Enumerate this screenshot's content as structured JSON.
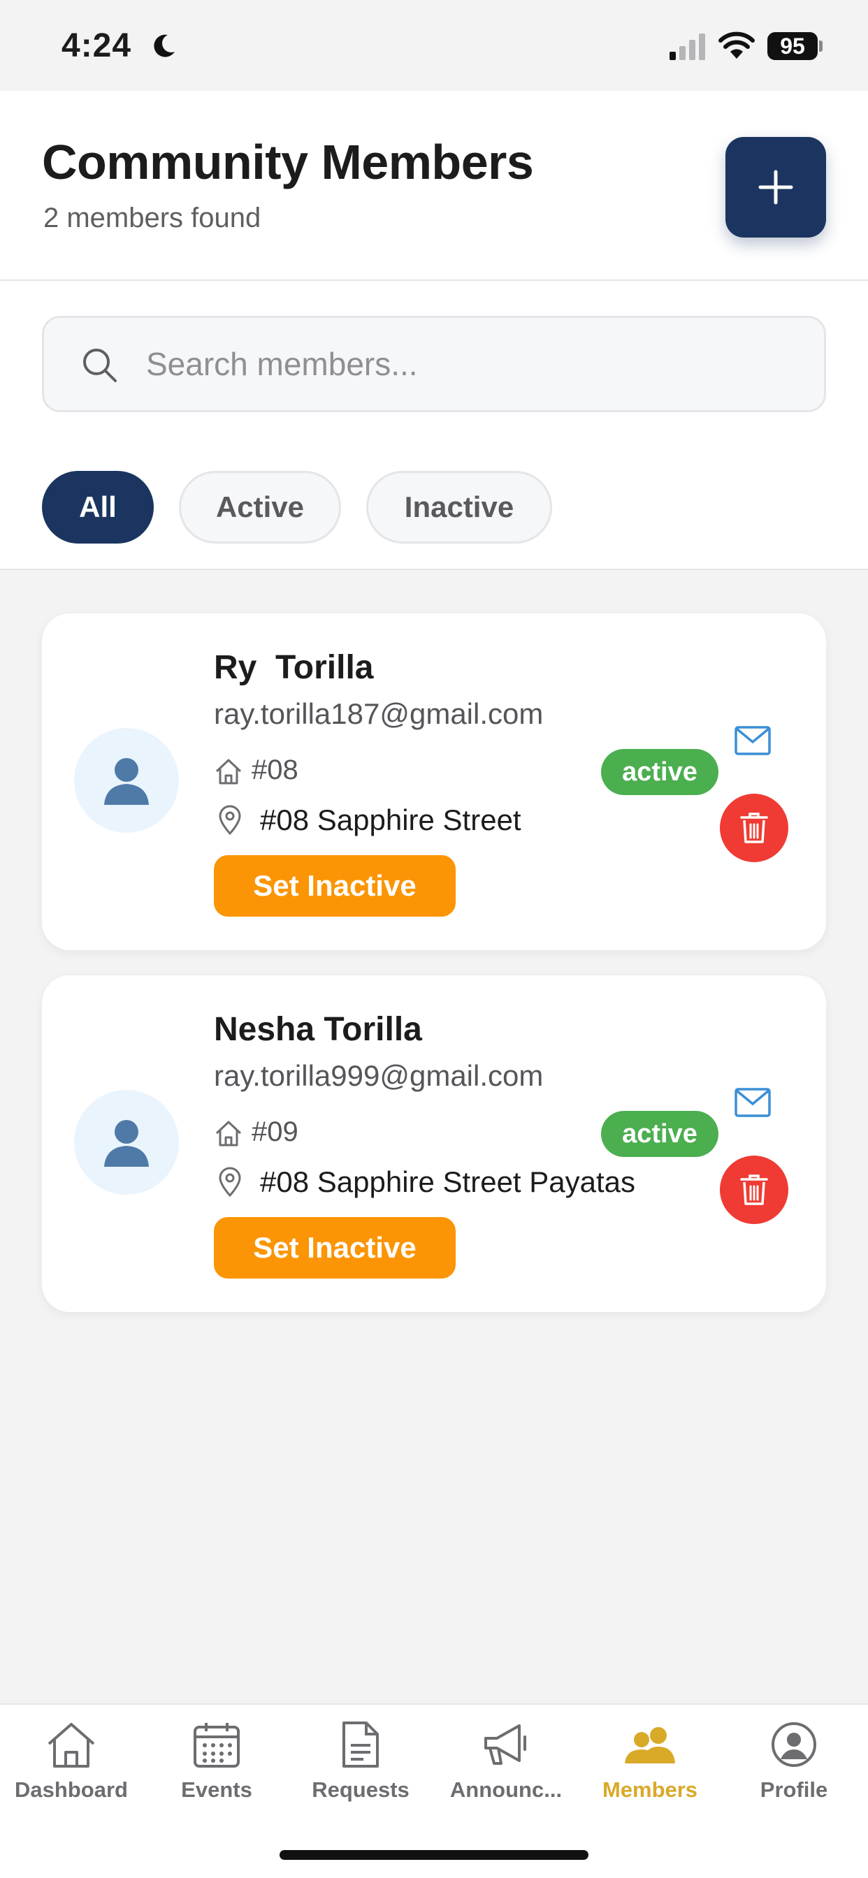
{
  "status_bar": {
    "time": "4:24",
    "battery": "95"
  },
  "header": {
    "title": "Community Members",
    "subtitle": "2 members found"
  },
  "search": {
    "placeholder": "Search members...",
    "value": ""
  },
  "filters": [
    {
      "label": "All",
      "selected": true
    },
    {
      "label": "Active",
      "selected": false
    },
    {
      "label": "Inactive",
      "selected": false
    }
  ],
  "members": [
    {
      "name": "Ry  Torilla",
      "email": "ray.torilla187@gmail.com",
      "house": "#08",
      "address": "#08 Sapphire Street",
      "status": "active",
      "action_label": "Set Inactive"
    },
    {
      "name": "Nesha Torilla",
      "email": "ray.torilla999@gmail.com",
      "house": "#09",
      "address": "#08 Sapphire Street Payatas",
      "status": "active",
      "action_label": "Set Inactive"
    }
  ],
  "tabs": [
    {
      "label": "Dashboard",
      "icon": "house-icon"
    },
    {
      "label": "Events",
      "icon": "calendar-icon"
    },
    {
      "label": "Requests",
      "icon": "document-icon"
    },
    {
      "label": "Announc...",
      "icon": "megaphone-icon"
    },
    {
      "label": "Members",
      "icon": "people-icon",
      "active": true
    },
    {
      "label": "Profile",
      "icon": "profile-icon"
    }
  ],
  "colors": {
    "primary": "#1b3560",
    "active_badge": "#4bae4f",
    "warning_button": "#fb9505",
    "delete_button": "#ef3b33",
    "active_tab": "#d9a928",
    "mail_icon": "#3a8fd6"
  }
}
